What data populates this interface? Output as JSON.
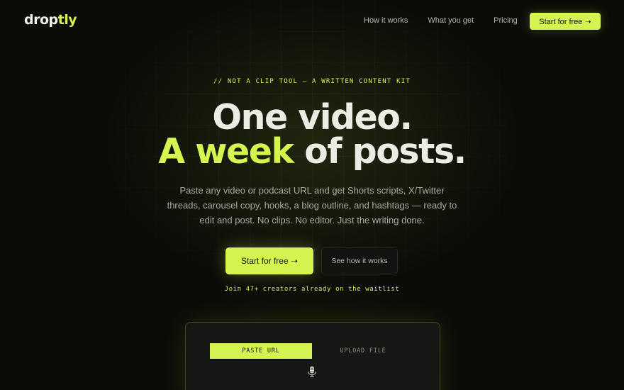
{
  "nav": {
    "logo_main": "drop",
    "logo_accent": "tly",
    "links": [
      "How it works",
      "What you get",
      "Pricing"
    ],
    "cta_label": "Start for free ➝"
  },
  "hero": {
    "eyebrow": "// NOT A CLIP TOOL — A WRITTEN CONTENT KIT",
    "headline_line1": "One video.",
    "headline_line2_accent": "A week",
    "headline_line2_rest": " of posts.",
    "subtitle": "Paste any video or podcast URL and get Shorts scripts, X/Twitter threads, carousel copy, hooks, a blog outline, and hashtags — ready to edit and post. No clips. No editor. Just the writing done.",
    "primary_cta": "Start for free ➝",
    "secondary_cta": "See how it works",
    "waitlist": "Join 47+ creators already on the waitlist"
  },
  "input_card": {
    "tabs": [
      "PASTE URL",
      "UPLOAD FILE"
    ],
    "active_tab": "PASTE URL",
    "icon": "microphone-icon"
  },
  "colors": {
    "accent": "#d4f550",
    "background": "#0b0c08",
    "text": "#ecece4",
    "muted": "#a9aaa0"
  }
}
